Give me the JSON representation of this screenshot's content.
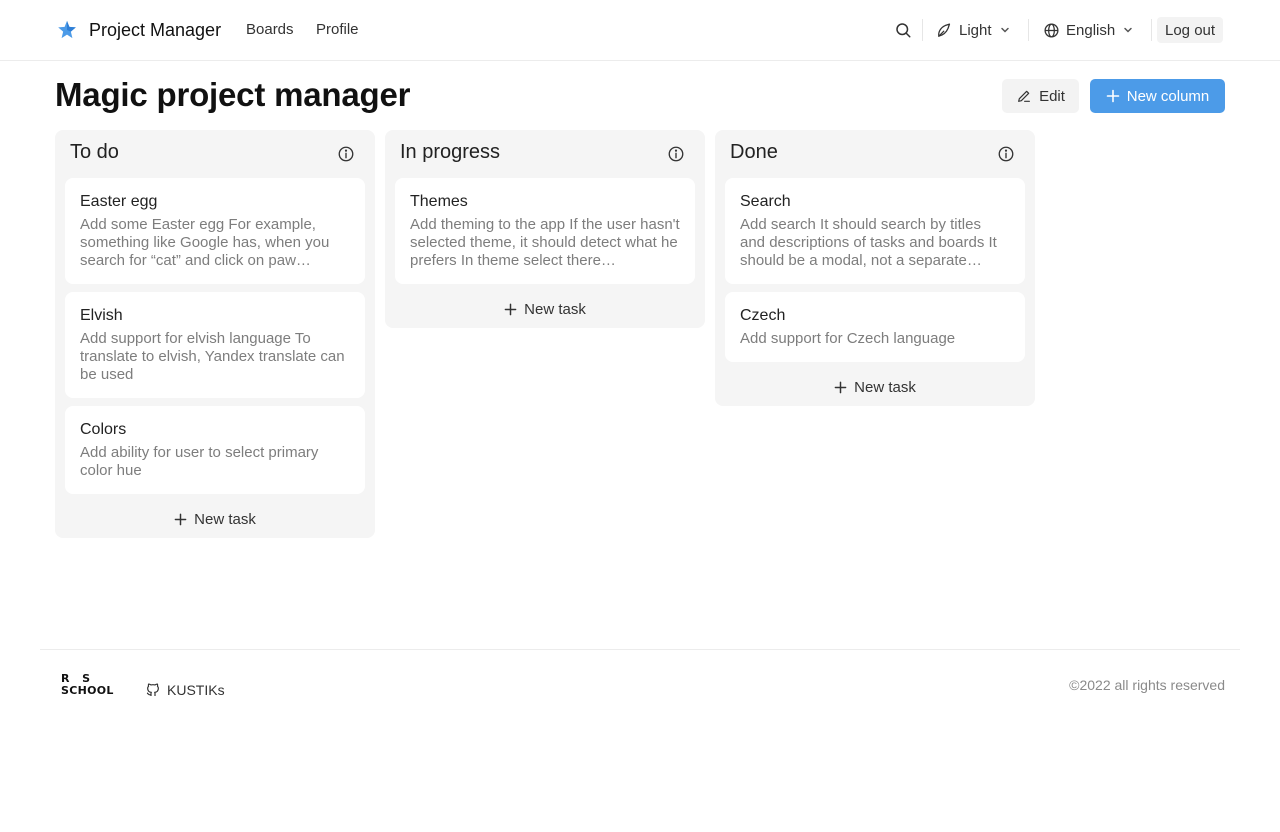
{
  "header": {
    "brand": "Project Manager",
    "nav": {
      "boards": "Boards",
      "profile": "Profile"
    },
    "theme": "Light",
    "language": "English",
    "logout": "Log out",
    "icons": [
      "star-logo-icon",
      "search-icon",
      "theme-icon",
      "chevron-down-icon",
      "globe-icon"
    ]
  },
  "page": {
    "title": "Magic project manager",
    "edit_label": "Edit",
    "new_column_label": "New column"
  },
  "columns": [
    {
      "title": "To do",
      "new_task_label": "New task",
      "tasks": [
        {
          "title": "Easter egg",
          "description": "Add some Easter egg For example, something like Google has, when you search for “cat” and click on paw…"
        },
        {
          "title": "Elvish",
          "description": "Add support for elvish language To translate to elvish, Yandex translate can be used"
        },
        {
          "title": "Colors",
          "description": "Add ability for user to select primary color hue"
        }
      ]
    },
    {
      "title": "In progress",
      "new_task_label": "New task",
      "tasks": [
        {
          "title": "Themes",
          "description": "Add theming to the app If the user hasn't selected theme, it should detect what he prefers In theme select there…"
        }
      ]
    },
    {
      "title": "Done",
      "new_task_label": "New task",
      "tasks": [
        {
          "title": "Search",
          "description": "Add search It should search by titles and descriptions of tasks and boards It should be a modal, not a separate…"
        },
        {
          "title": "Czech",
          "description": "Add support for Czech language"
        }
      ]
    }
  ],
  "footer": {
    "school_logo": "RS SCHOOL",
    "github_user": "KUSTIKs",
    "copyright": "©2022 all rights reserved"
  },
  "colors": {
    "accent": "#4c9be8",
    "column_bg": "#f5f5f5",
    "muted_text": "#7d7d7d"
  }
}
